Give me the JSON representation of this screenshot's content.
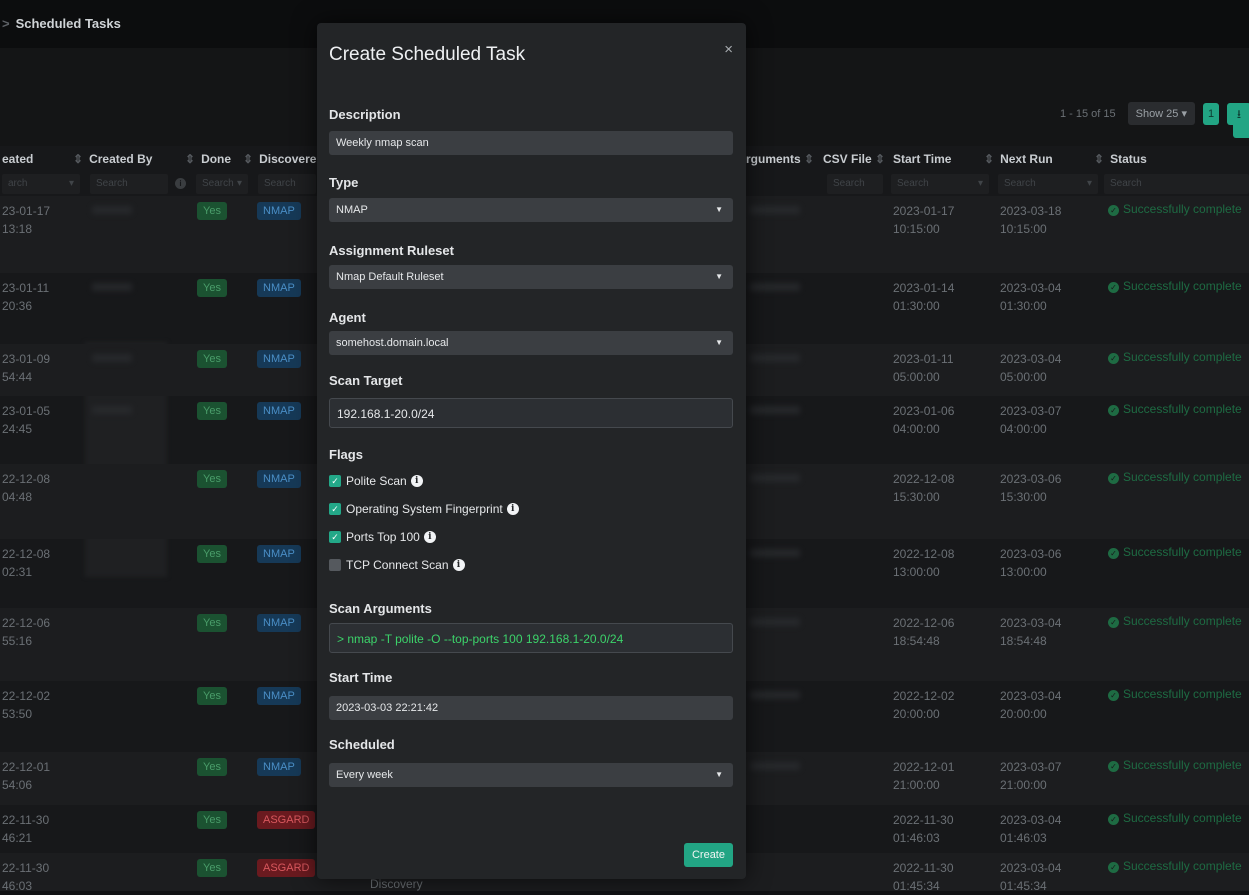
{
  "header": {
    "breadcrumb": "Scheduled Tasks"
  },
  "pagination": {
    "range": "1 - 15 of 15",
    "show": "Show 25",
    "page": "1"
  },
  "table": {
    "columns": {
      "created": "eated",
      "created_by": "Created By",
      "done": "Done",
      "discovered": "Discovere",
      "arguments": "rguments",
      "csv_file": "CSV File",
      "start_time": "Start Time",
      "next_run": "Next Run",
      "status": "Status"
    },
    "filters": {
      "created": "arch",
      "created_by": "Search",
      "done": "Search",
      "discovered": "Search",
      "csv": "Search",
      "start": "Search",
      "next": "Search",
      "status": "Search"
    },
    "rows": [
      {
        "created_date": "23-01-17",
        "created_time": "13:18",
        "done": "Yes",
        "type": "NMAP",
        "start_date": "2023-01-17",
        "start_time": "10:15:00",
        "next_date": "2023-03-18",
        "next_time": "10:15:00",
        "status": "Successfully complete"
      },
      {
        "created_date": "23-01-11",
        "created_time": "20:36",
        "done": "Yes",
        "type": "NMAP",
        "start_date": "2023-01-14",
        "start_time": "01:30:00",
        "next_date": "2023-03-04",
        "next_time": "01:30:00",
        "status": "Successfully complete"
      },
      {
        "created_date": "23-01-09",
        "created_time": "54:44",
        "done": "Yes",
        "type": "NMAP",
        "start_date": "2023-01-11",
        "start_time": "05:00:00",
        "next_date": "2023-03-04",
        "next_time": "05:00:00",
        "status": "Successfully complete"
      },
      {
        "created_date": "23-01-05",
        "created_time": "24:45",
        "done": "Yes",
        "type": "NMAP",
        "start_date": "2023-01-06",
        "start_time": "04:00:00",
        "next_date": "2023-03-07",
        "next_time": "04:00:00",
        "status": "Successfully complete"
      },
      {
        "created_date": "22-12-08",
        "created_time": "04:48",
        "done": "Yes",
        "type": "NMAP",
        "start_date": "2022-12-08",
        "start_time": "15:30:00",
        "next_date": "2023-03-06",
        "next_time": "15:30:00",
        "status": "Successfully complete"
      },
      {
        "created_date": "22-12-08",
        "created_time": "02:31",
        "done": "Yes",
        "type": "NMAP",
        "start_date": "2022-12-08",
        "start_time": "13:00:00",
        "next_date": "2023-03-06",
        "next_time": "13:00:00",
        "status": "Successfully complete"
      },
      {
        "created_date": "22-12-06",
        "created_time": "55:16",
        "done": "Yes",
        "type": "NMAP",
        "start_date": "2022-12-06",
        "start_time": "18:54:48",
        "next_date": "2023-03-04",
        "next_time": "18:54:48",
        "status": "Successfully complete"
      },
      {
        "created_date": "22-12-02",
        "created_time": "53:50",
        "done": "Yes",
        "type": "NMAP",
        "start_date": "2022-12-02",
        "start_time": "20:00:00",
        "next_date": "2023-03-04",
        "next_time": "20:00:00",
        "status": "Successfully complete"
      },
      {
        "created_date": "22-12-01",
        "created_time": "54:06",
        "done": "Yes",
        "type": "NMAP",
        "start_date": "2022-12-01",
        "start_time": "21:00:00",
        "next_date": "2023-03-07",
        "next_time": "21:00:00",
        "status": "Successfully complete"
      },
      {
        "created_date": "22-11-30",
        "created_time": "46:21",
        "done": "Yes",
        "type": "ASGARD",
        "start_date": "2022-11-30",
        "start_time": "01:46:03",
        "next_date": "2023-03-04",
        "next_time": "01:46:03",
        "status": "Successfully complete"
      },
      {
        "created_date": "22-11-30",
        "created_time": "46:03",
        "done": "Yes",
        "type": "ASGARD",
        "extra": "Discovery",
        "start_date": "2022-11-30",
        "start_time": "01:45:34",
        "next_date": "2023-03-04",
        "next_time": "01:45:34",
        "status": "Successfully complete"
      }
    ]
  },
  "modal": {
    "title": "Create Scheduled Task",
    "close": "×",
    "description": {
      "label": "Description",
      "value": "Weekly nmap scan"
    },
    "type": {
      "label": "Type",
      "value": "NMAP"
    },
    "ruleset": {
      "label": "Assignment Ruleset",
      "value": "Nmap Default Ruleset"
    },
    "agent": {
      "label": "Agent",
      "value": "somehost.domain.local"
    },
    "target": {
      "label": "Scan Target",
      "value": "192.168.1-20.0/24"
    },
    "flags": {
      "label": "Flags",
      "items": [
        {
          "label": "Polite Scan",
          "checked": true
        },
        {
          "label": "Operating System Fingerprint",
          "checked": true
        },
        {
          "label": "Ports Top 100",
          "checked": true,
          "info": false
        },
        {
          "label": "TCP Connect Scan",
          "checked": false
        }
      ]
    },
    "arguments": {
      "label": "Scan Arguments",
      "value": "> nmap -T polite  -O  --top-ports 100 192.168.1-20.0/24"
    },
    "start_time": {
      "label": "Start Time",
      "value": "2023-03-03 22:21:42"
    },
    "scheduled": {
      "label": "Scheduled",
      "value": "Every week"
    },
    "create_button": "Create"
  }
}
